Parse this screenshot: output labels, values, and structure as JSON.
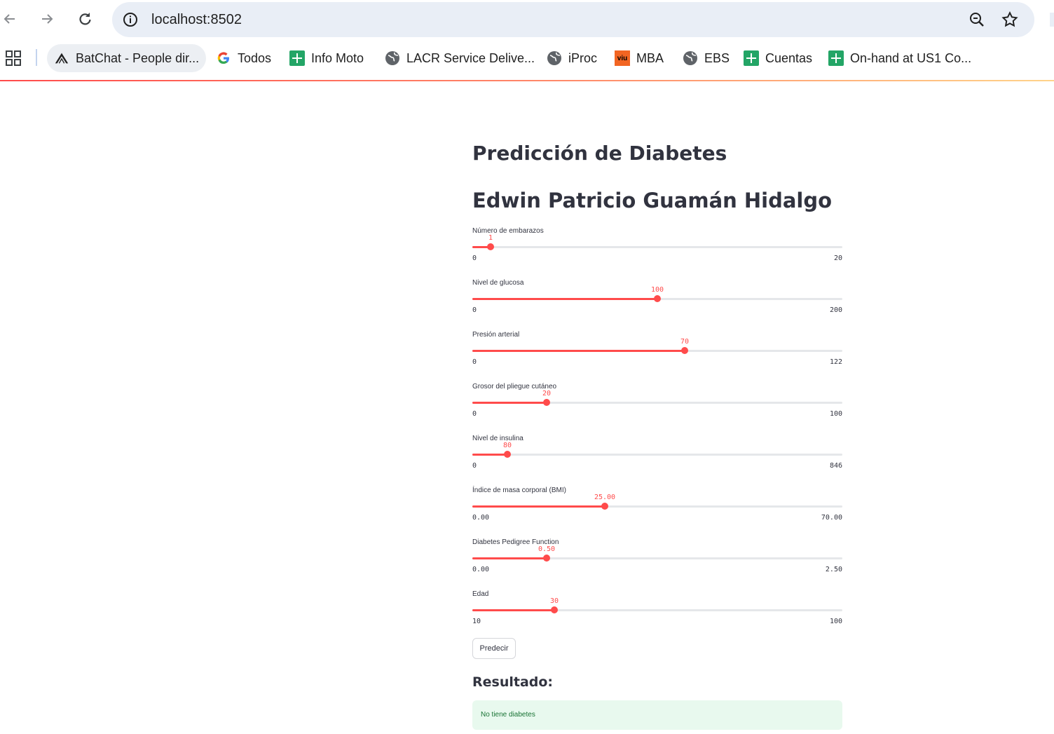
{
  "browser": {
    "url": "localhost:8502",
    "bookmarks": [
      {
        "label": "BatChat - People dir...",
        "icon": "batchat-icon"
      },
      {
        "label": "Todos",
        "icon": "google-icon"
      },
      {
        "label": "Info Moto",
        "icon": "sheets-icon"
      },
      {
        "label": "LACR Service Delive...",
        "icon": "globe-icon"
      },
      {
        "label": "iProc",
        "icon": "globe-icon"
      },
      {
        "label": "MBA",
        "icon": "viu-icon"
      },
      {
        "label": "EBS",
        "icon": "globe-icon"
      },
      {
        "label": "Cuentas",
        "icon": "sheets-icon"
      },
      {
        "label": "On-hand at US1 Co...",
        "icon": "sheets-icon"
      }
    ],
    "viu_text": "viu"
  },
  "app": {
    "title": "Predicción de Diabetes",
    "author": "Edwin Patricio Guamán Hidalgo",
    "accent_color": "#ff4b4b",
    "sliders": [
      {
        "label": "Número de embarazos",
        "value": "1",
        "min": "0",
        "max": "20",
        "fraction": 0.05
      },
      {
        "label": "Nivel de glucosa",
        "value": "100",
        "min": "0",
        "max": "200",
        "fraction": 0.5
      },
      {
        "label": "Presión arterial",
        "value": "70",
        "min": "0",
        "max": "122",
        "fraction": 0.5738
      },
      {
        "label": "Grosor del pliegue cutáneo",
        "value": "20",
        "min": "0",
        "max": "100",
        "fraction": 0.2
      },
      {
        "label": "Nivel de insulina",
        "value": "80",
        "min": "0",
        "max": "846",
        "fraction": 0.0946
      },
      {
        "label": "Índice de masa corporal (BMI)",
        "value": "25.00",
        "min": "0.00",
        "max": "70.00",
        "fraction": 0.3571
      },
      {
        "label": "Diabetes Pedigree Function",
        "value": "0.50",
        "min": "0.00",
        "max": "2.50",
        "fraction": 0.2
      },
      {
        "label": "Edad",
        "value": "30",
        "min": "10",
        "max": "100",
        "fraction": 0.2222
      }
    ],
    "predict_button": "Predecir",
    "result_heading": "Resultado:",
    "result_text": "No tiene diabetes"
  }
}
